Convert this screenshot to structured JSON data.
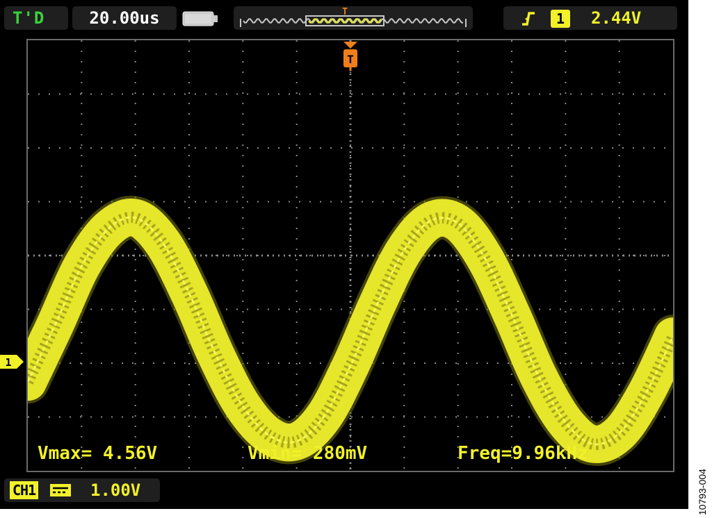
{
  "header": {
    "run_status": "T'D",
    "timebase": "20.00us",
    "trigger_level": "2.44V",
    "trigger_source": "1",
    "trigger_edge": "rising",
    "trigger_marker": "T"
  },
  "channel": {
    "label": "CH1",
    "marker": "1",
    "scale": "1.00V",
    "coupling": "DC"
  },
  "measurements": {
    "vmax": "Vmax= 4.56V",
    "vmin": "Vmin= 280mV",
    "freq": "Freq=9.96kHz"
  },
  "figure_id": "10793-004",
  "colors": {
    "trace": "#e6e62a",
    "grid": "#8a8a8a",
    "run_status": "#3ad23a",
    "trigger": "#f07f1a",
    "background": "#000000"
  },
  "chart_data": {
    "type": "line",
    "title": "",
    "xlabel": "",
    "ylabel": "",
    "x_unit": "us",
    "y_unit": "V",
    "x_divisions": 12,
    "y_divisions": 8,
    "xlim": [
      -120,
      120
    ],
    "ylim": [
      -0.2,
      7.8
    ],
    "grid": true,
    "series": [
      {
        "x": [
          -120,
          -110,
          -100,
          -90,
          -80,
          -70,
          -60,
          -50,
          -40,
          -30,
          -20,
          -10,
          0,
          10,
          20,
          30,
          40,
          50,
          60,
          70,
          80,
          90,
          100,
          110,
          120
        ],
        "y": [
          1.45,
          2.5,
          3.6,
          4.3,
          4.5,
          4.05,
          3.1,
          1.95,
          1.0,
          0.45,
          0.35,
          0.8,
          1.75,
          2.9,
          3.9,
          4.45,
          4.4,
          3.75,
          2.7,
          1.55,
          0.7,
          0.3,
          0.5,
          1.25,
          2.3
        ],
        "noise_band": 0.35
      }
    ],
    "channel_zero_level": 0.0,
    "trigger_time": 0,
    "trigger_level": 2.44
  }
}
